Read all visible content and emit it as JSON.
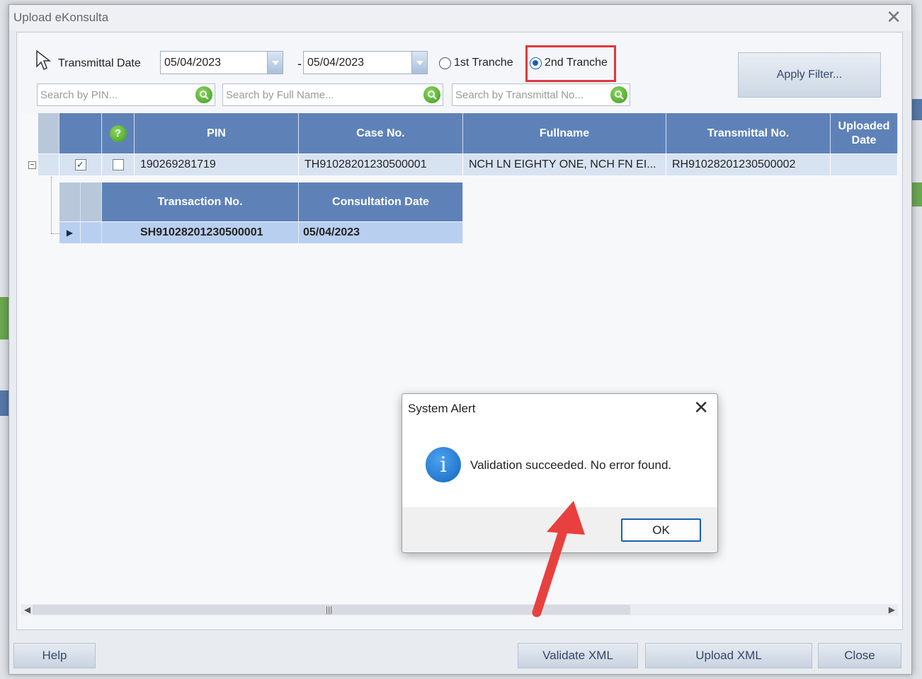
{
  "window": {
    "title": "Upload eKonsulta"
  },
  "filter": {
    "transmittal_label": "Transmittal Date",
    "date_from": "05/04/2023",
    "date_separator": "-",
    "date_to": "05/04/2023",
    "tranche_1": "1st Tranche",
    "tranche_2": "2nd Tranche",
    "selected_tranche": "2nd Tranche",
    "search_pin_placeholder": "Search by PIN...",
    "search_name_placeholder": "Search by Full Name...",
    "search_transmittal_placeholder": "Search by Transmittal No...",
    "apply_label": "Apply Filter..."
  },
  "grid": {
    "columns": [
      "PIN",
      "Case No.",
      "Fullname",
      "Transmittal No.",
      "Uploaded Date"
    ],
    "help_icon": "?",
    "rows": [
      {
        "pin": "190269281719",
        "case_no": "TH91028201230500001",
        "fullname": "NCH LN EIGHTY ONE, NCH FN EI...",
        "transmittal_no": "RH91028201230500002",
        "uploaded_date": "",
        "checked": true
      }
    ],
    "sub_columns": [
      "Transaction No.",
      "Consultation Date"
    ],
    "sub_rows": [
      {
        "transaction_no": "SH91028201230500001",
        "consultation_date": "05/04/2023"
      }
    ]
  },
  "buttons": {
    "help": "Help",
    "validate": "Validate XML",
    "upload": "Upload XML",
    "close": "Close"
  },
  "dialog": {
    "title": "System Alert",
    "message": "Validation succeeded. No error found.",
    "ok": "OK"
  },
  "colors": {
    "header_blue": "#5e82b8",
    "highlight_red": "#e0393e",
    "annotation_arrow": "#e8403f",
    "info_blue": "#1565c0"
  }
}
